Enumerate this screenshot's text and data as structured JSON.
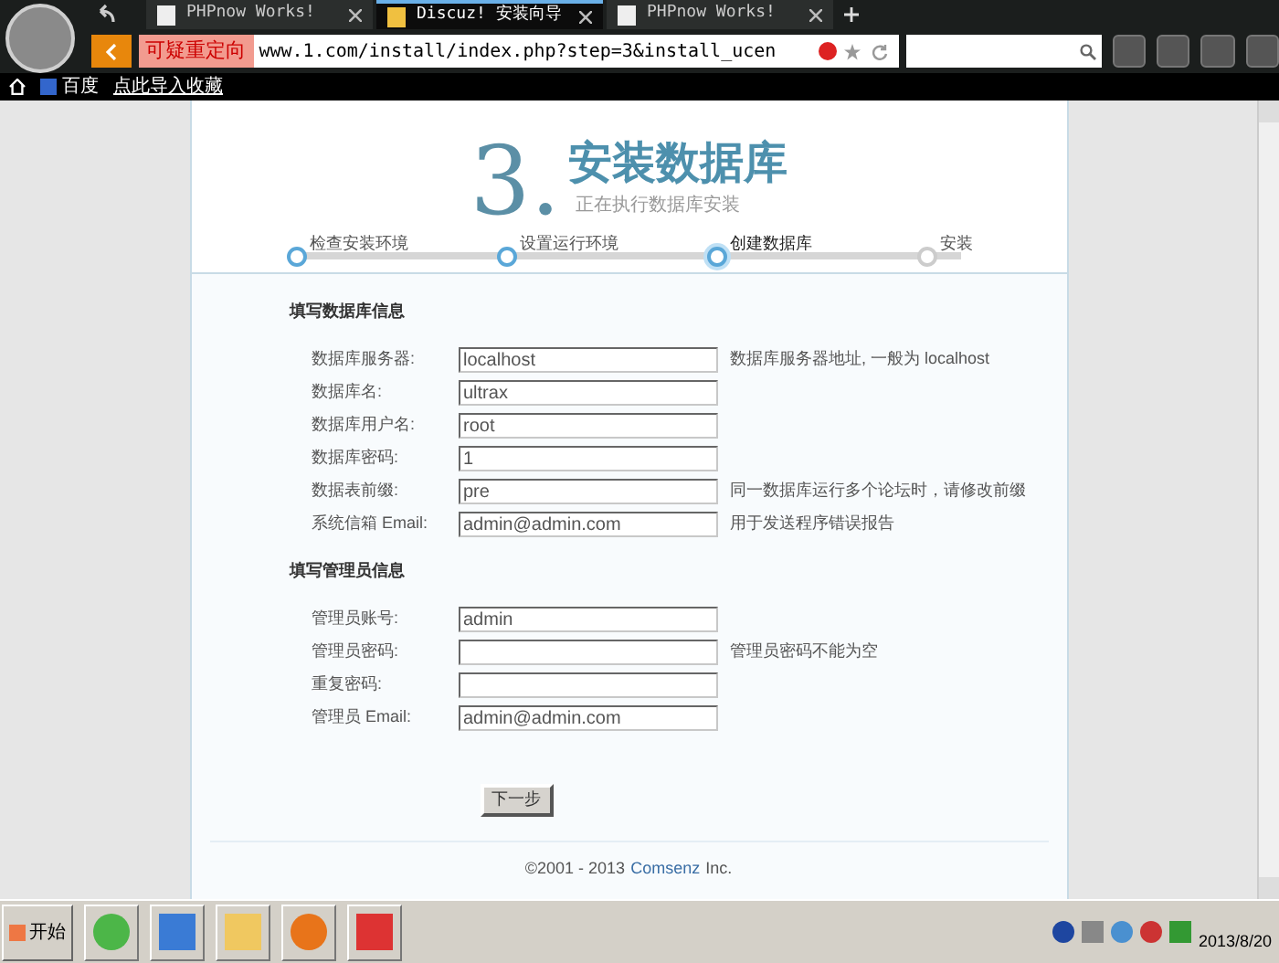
{
  "browser": {
    "tabs": [
      {
        "title": "PHPnow Works!",
        "selected": false
      },
      {
        "title": "Discuz! 安装向导",
        "selected": true
      },
      {
        "title": "PHPnow Works!",
        "selected": false
      }
    ],
    "redirect_label": "可疑重定向",
    "address": "www.1.com/install/index.php?step=3&install_ucen",
    "bookmarks": [
      {
        "label": "百度"
      },
      {
        "label": "点此导入收藏"
      }
    ]
  },
  "page": {
    "step_number": "3.",
    "title": "安装数据库",
    "subtitle": "正在执行数据库安装",
    "steps": [
      {
        "label": "检查安装环境",
        "kind": "done"
      },
      {
        "label": "设置运行环境",
        "kind": "done"
      },
      {
        "label": "创建数据库",
        "kind": "current"
      },
      {
        "label": "安装",
        "kind": "pending"
      }
    ],
    "sections": [
      {
        "heading": "填写数据库信息",
        "fields": [
          {
            "label": "数据库服务器:",
            "value": "localhost",
            "hint": "数据库服务器地址, 一般为 localhost"
          },
          {
            "label": "数据库名:",
            "value": "ultrax"
          },
          {
            "label": "数据库用户名:",
            "value": "root"
          },
          {
            "label": "数据库密码:",
            "value": "1"
          },
          {
            "label": "数据表前缀:",
            "value": "pre",
            "hint": "同一数据库运行多个论坛时，请修改前缀"
          },
          {
            "label": "系统信箱 Email:",
            "value": "admin@admin.com",
            "hint": "用于发送程序错误报告"
          }
        ]
      },
      {
        "heading": "填写管理员信息",
        "fields": [
          {
            "label": "管理员账号:",
            "value": "admin"
          },
          {
            "label": "管理员密码:",
            "hint": "管理员密码不能为空"
          },
          {
            "label": "重复密码:"
          },
          {
            "label": "管理员 Email:",
            "value": "admin@admin.com"
          }
        ]
      }
    ],
    "next_button": "下一步",
    "footer_prefix": "©2001 - 2013",
    "footer_link": "Comsenz",
    "footer_suffix": "Inc."
  },
  "taskbar": {
    "start": "开始",
    "date": "2013/8/20"
  }
}
